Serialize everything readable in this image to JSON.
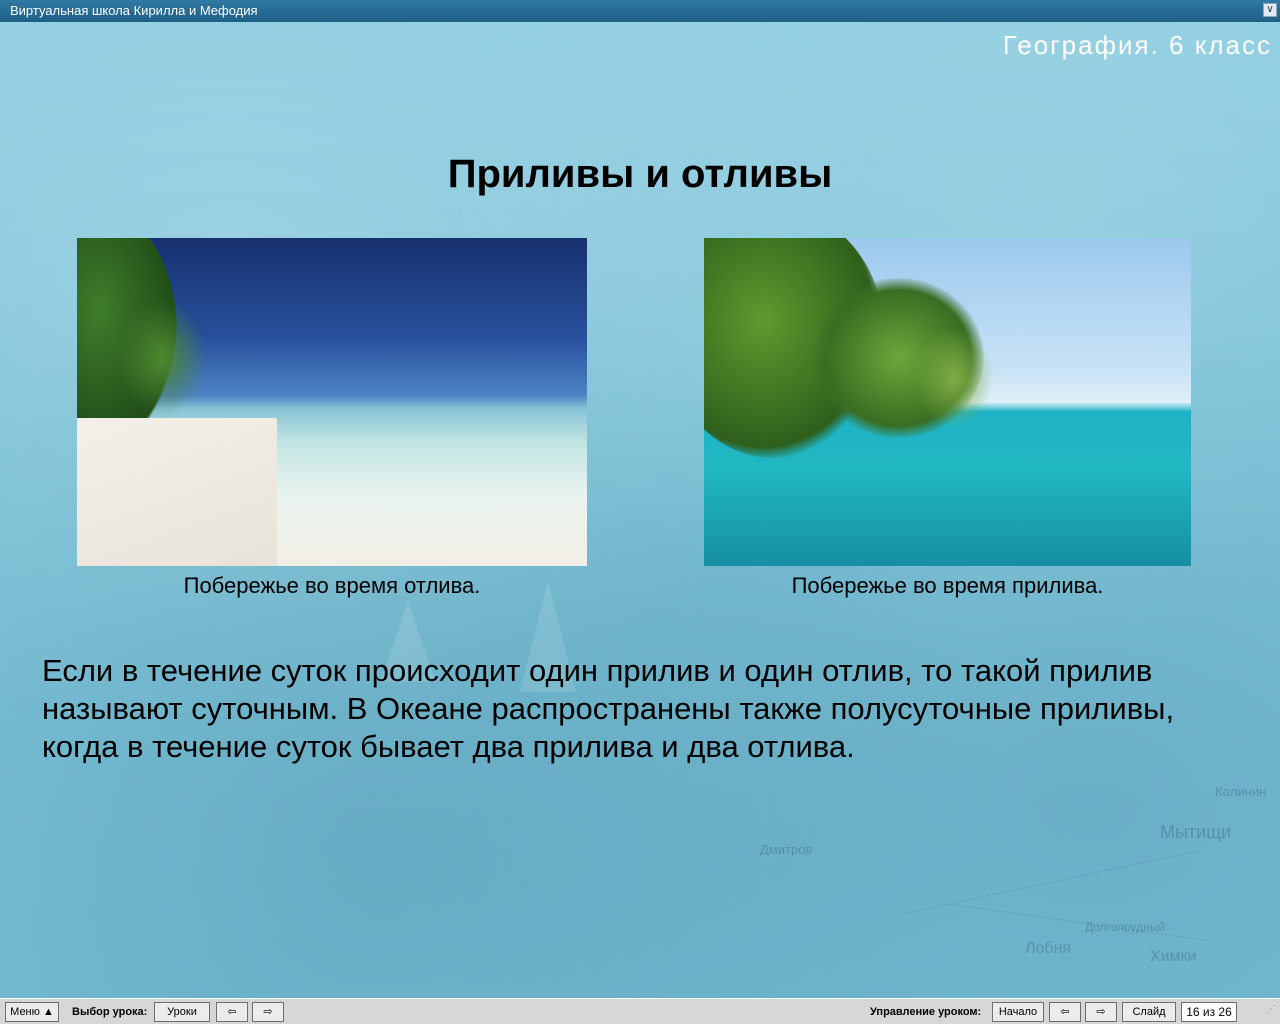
{
  "window": {
    "title": "Виртуальная школа Кирилла и Мефодия"
  },
  "slide": {
    "subject": "География. 6 класс",
    "lesson_title": "Приливы и отливы",
    "photos": [
      {
        "caption": "Побережье во время отлива."
      },
      {
        "caption": "Побережье во время прилива."
      }
    ],
    "body_text": "Если в течение суток происходит один прилив и один отлив, то такой прилив называют суточным. В Океане распространены также полусуточные приливы, когда в течение суток бывает два прилива и два отлива."
  },
  "background_map_labels": [
    "Мытищи",
    "Лобня",
    "Химки",
    "Долгопрудный",
    "Дмитров",
    "Калинин"
  ],
  "toolbar": {
    "menu_label": "Меню ▲",
    "lesson_select_label": "Выбор урока:",
    "lessons_label": "Уроки",
    "prev_lesson_icon": "arrow-left-icon",
    "next_lesson_icon": "arrow-right-icon",
    "control_label": "Управление уроком:",
    "start_label": "Начало",
    "prev_slide_icon": "arrow-left-icon",
    "next_slide_icon": "arrow-right-icon",
    "slide_label": "Слайд",
    "slide_counter": "16 из 26"
  }
}
